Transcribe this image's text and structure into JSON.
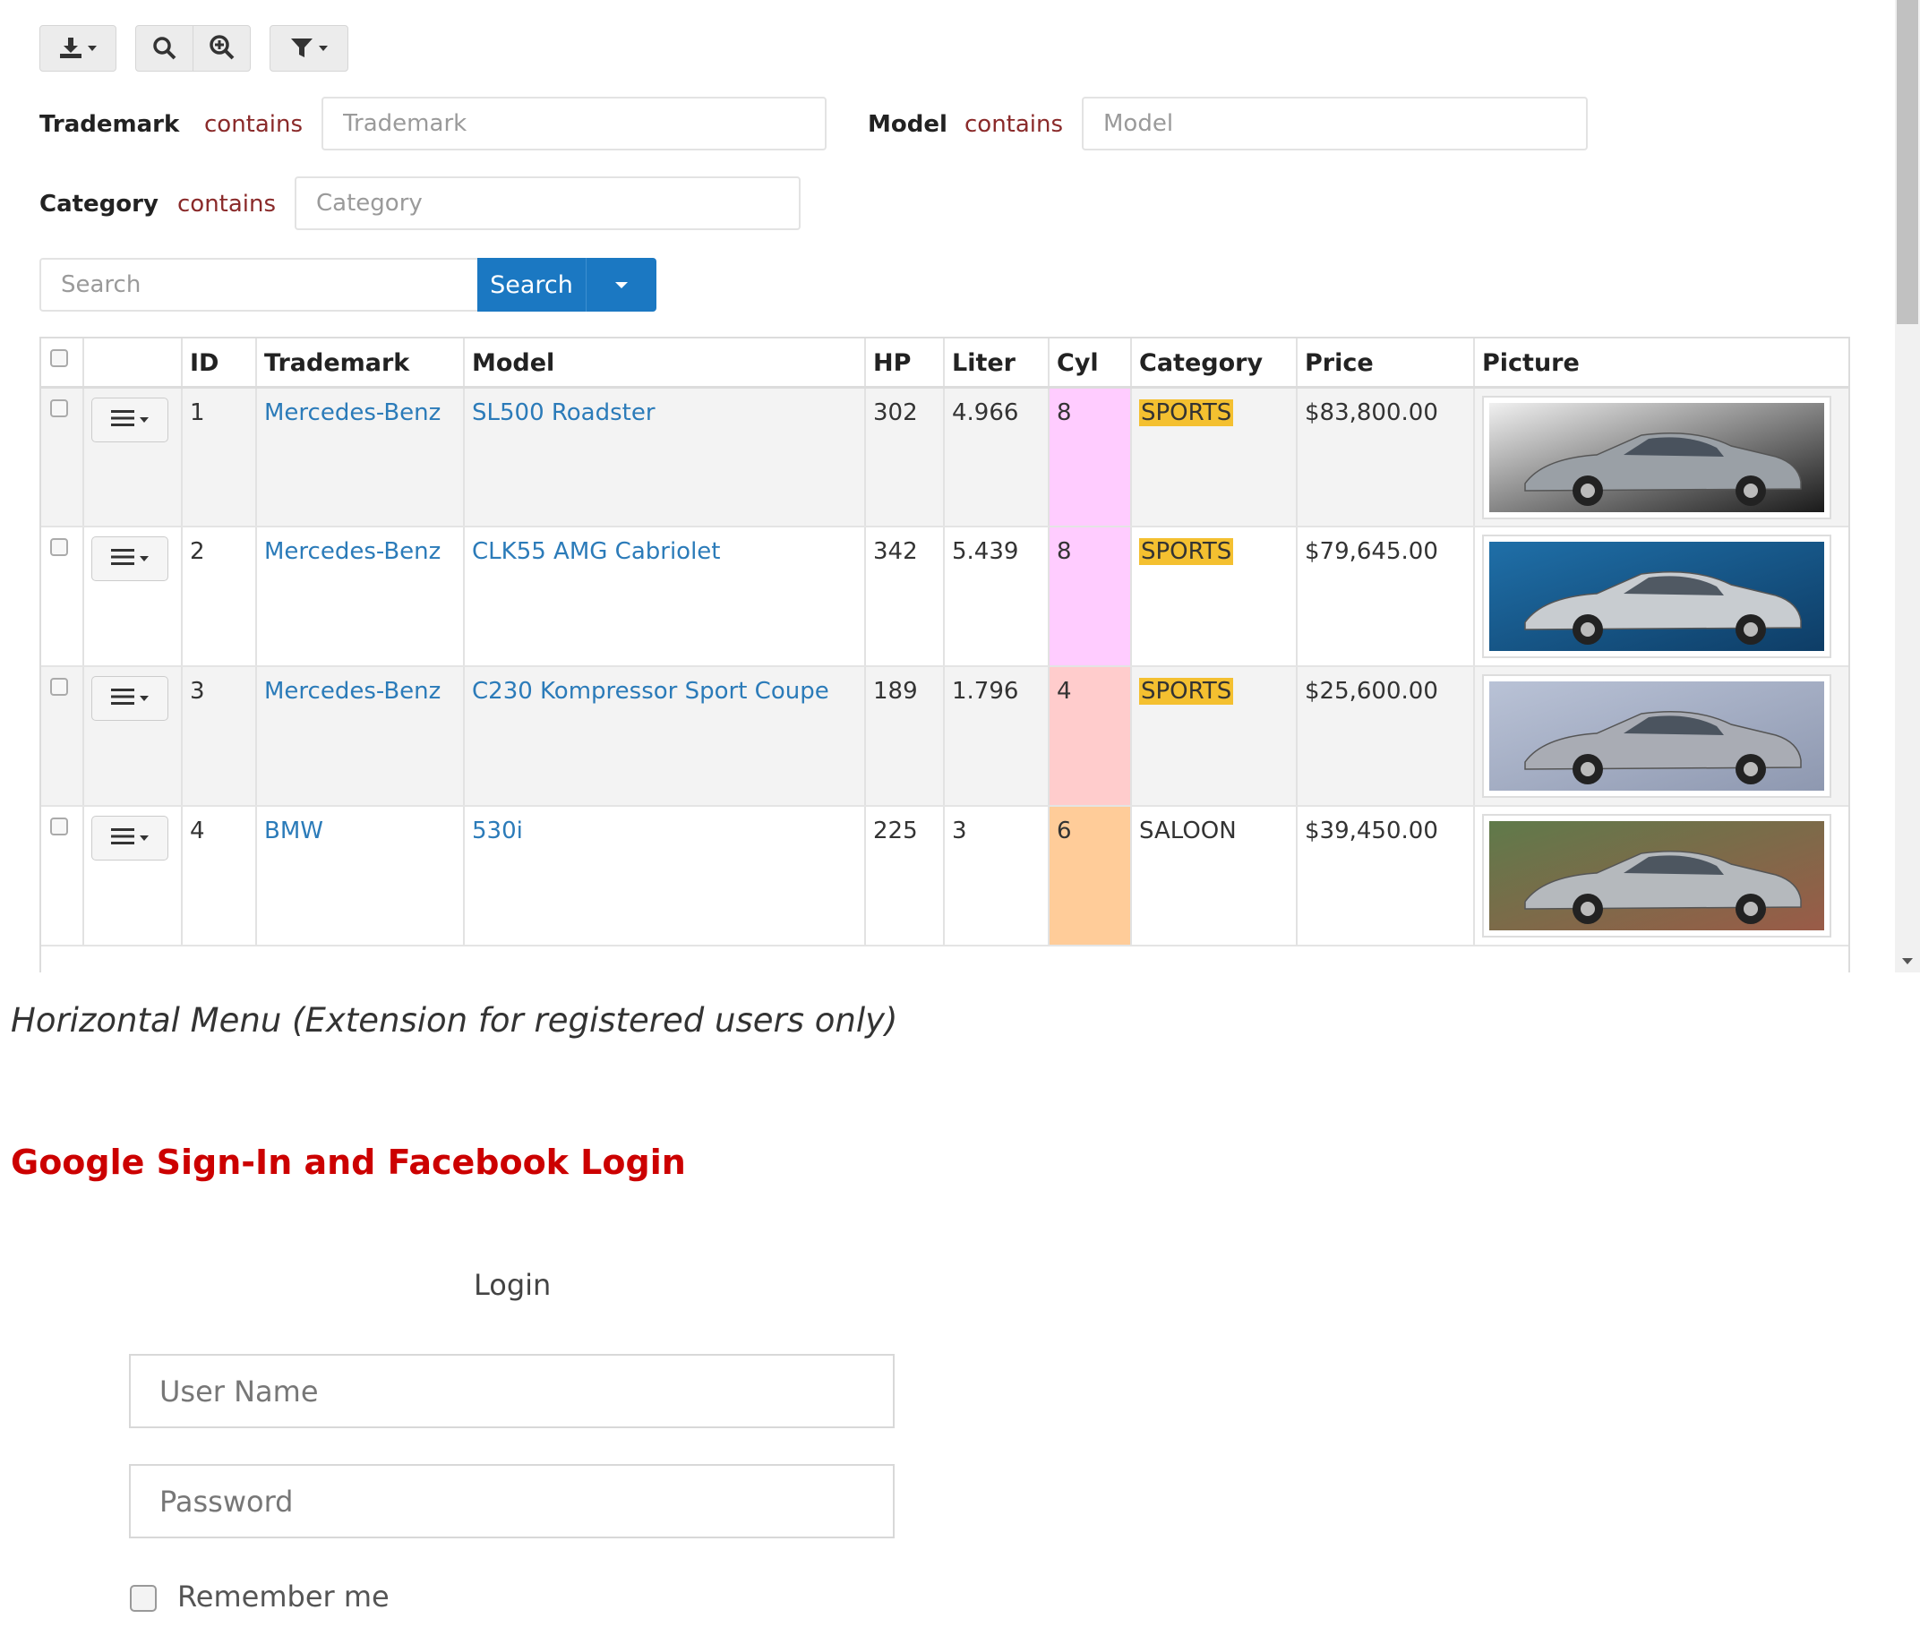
{
  "toolbar": {
    "export_icon": "download-icon",
    "search_icon": "search-icon",
    "advanced_search_icon": "zoom-search-icon",
    "filter_icon": "filter-icon"
  },
  "filters": {
    "trademark": {
      "label": "Trademark",
      "operator": "contains",
      "placeholder": "Trademark"
    },
    "model": {
      "label": "Model",
      "operator": "contains",
      "placeholder": "Model"
    },
    "category": {
      "label": "Category",
      "operator": "contains",
      "placeholder": "Category"
    }
  },
  "search": {
    "placeholder": "Search",
    "button_label": "Search"
  },
  "grid": {
    "columns": [
      "ID",
      "Trademark",
      "Model",
      "HP",
      "Liter",
      "Cyl",
      "Category",
      "Price",
      "Picture"
    ],
    "rows": [
      {
        "id": "1",
        "trademark": "Mercedes-Benz",
        "model": "SL500 Roadster",
        "hp": "302",
        "liter": "4.966",
        "cyl": "8",
        "category": "SPORTS",
        "price": "$83,800.00",
        "cyl_color": "#ffccff",
        "car_color": "#9aa0a6"
      },
      {
        "id": "2",
        "trademark": "Mercedes-Benz",
        "model": "CLK55 AMG Cabriolet",
        "hp": "342",
        "liter": "5.439",
        "cyl": "8",
        "category": "SPORTS",
        "price": "$79,645.00",
        "cyl_color": "#ffccff",
        "car_color": "#c8ccd0"
      },
      {
        "id": "3",
        "trademark": "Mercedes-Benz",
        "model": "C230 Kompressor Sport Coupe",
        "hp": "189",
        "liter": "1.796",
        "cyl": "4",
        "category": "SPORTS",
        "price": "$25,600.00",
        "cyl_color": "#ffcccc",
        "car_color": "#a9acb4"
      },
      {
        "id": "4",
        "trademark": "BMW",
        "model": "530i",
        "hp": "225",
        "liter": "3",
        "cyl": "6",
        "category": "SALOON",
        "price": "$39,450.00",
        "cyl_color": "#ffcc99",
        "car_color": "#b5b9bd"
      }
    ]
  },
  "caption": "Horizontal Menu (Extension for registered users only)",
  "heading": "Google Sign-In and Facebook Login",
  "login": {
    "title": "Login",
    "username_placeholder": "User Name",
    "password_placeholder": "Password",
    "remember_label": "Remember me"
  },
  "colors": {
    "accent": "#1b78c2",
    "heading": "#cc0000",
    "link": "#2b7bb9",
    "sports_badge": "#f4c030"
  }
}
